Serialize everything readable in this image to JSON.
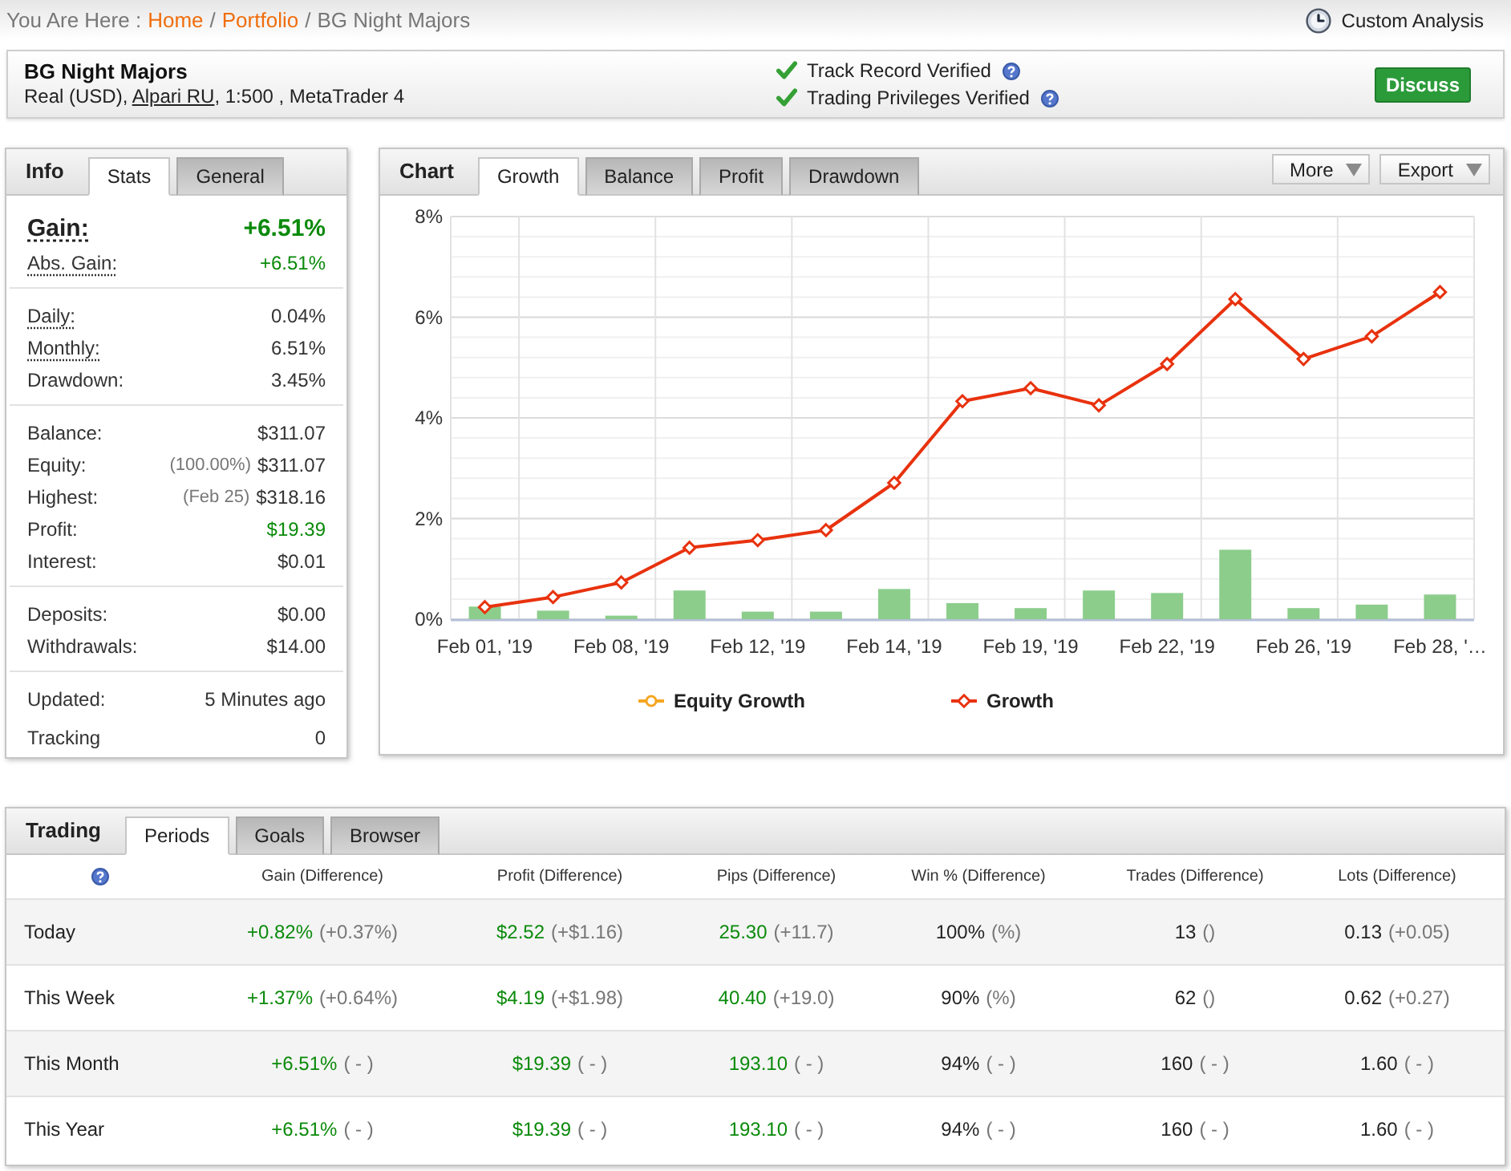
{
  "breadcrumb": [
    {
      "kind": "label",
      "text": "You Are Here :"
    },
    {
      "kind": "link",
      "text": "Home"
    },
    {
      "kind": "separator",
      "text": "/"
    },
    {
      "kind": "link",
      "text": "Portfolio"
    },
    {
      "kind": "separator",
      "text": "/"
    },
    {
      "kind": "current",
      "text": "BG Night Majors"
    }
  ],
  "custom_analysis": {
    "label": "Custom Analysis"
  },
  "account": {
    "name": "BG Night Majors",
    "details": [
      {
        "kind": "text",
        "text": "Real (USD), "
      },
      {
        "kind": "link",
        "text": "Alpari RU"
      },
      {
        "kind": "text",
        "text": ", 1:500 , MetaTrader 4"
      }
    ],
    "verifications": [
      {
        "label": "Track Record Verified",
        "verified": true
      },
      {
        "label": "Trading Privileges Verified",
        "verified": true
      }
    ],
    "button": "Discuss"
  },
  "info_panel": {
    "title": "Info",
    "tabs": [
      {
        "label": "Stats",
        "selected": true
      },
      {
        "label": "General",
        "selected": false
      }
    ],
    "groups": [
      {
        "rows": [
          {
            "kind": "headline",
            "label": "Gain:",
            "value": "+6.51%",
            "underlined": true,
            "highlighted": true
          },
          {
            "kind": "stat",
            "label": "Abs. Gain:",
            "value": "+6.51%",
            "underlined": true,
            "highlighted": true
          }
        ]
      },
      {
        "rows": [
          {
            "kind": "stat",
            "label": "Daily:",
            "value": "0.04%",
            "underlined": true,
            "highlighted": false
          },
          {
            "kind": "stat",
            "label": "Monthly:",
            "value": "6.51%",
            "underlined": true,
            "highlighted": false
          },
          {
            "kind": "stat",
            "label": "Drawdown:",
            "value": "3.45%",
            "underlined": false,
            "highlighted": false
          }
        ]
      },
      {
        "rows": [
          {
            "kind": "stat",
            "label": "Balance:",
            "value": "$311.07",
            "underlined": false,
            "highlighted": false
          },
          {
            "kind": "stat",
            "label": "Equity:",
            "note": "(100.00%)",
            "value": "$311.07",
            "underlined": false,
            "highlighted": false
          },
          {
            "kind": "stat",
            "label": "Highest:",
            "note": "(Feb 25)",
            "value": "$318.16",
            "underlined": false,
            "highlighted": false
          },
          {
            "kind": "stat",
            "label": "Profit:",
            "value": "$19.39",
            "underlined": false,
            "highlighted": true
          },
          {
            "kind": "stat",
            "label": "Interest:",
            "value": "$0.01",
            "underlined": false,
            "highlighted": false
          }
        ]
      },
      {
        "rows": [
          {
            "kind": "stat",
            "label": "Deposits:",
            "value": "$0.00",
            "underlined": false,
            "highlighted": false
          },
          {
            "kind": "stat",
            "label": "Withdrawals:",
            "value": "$14.00",
            "underlined": false,
            "highlighted": false
          }
        ]
      },
      {
        "rows": [
          {
            "kind": "stat",
            "label": "Updated:",
            "value": "5 Minutes ago",
            "underlined": false,
            "highlighted": false
          },
          {
            "kind": "stat",
            "label": "Tracking",
            "value": "0",
            "underlined": false,
            "highlighted": false
          }
        ]
      }
    ]
  },
  "chart_panel": {
    "title": "Chart",
    "tabs": [
      {
        "label": "Growth",
        "selected": true
      },
      {
        "label": "Balance",
        "selected": false
      },
      {
        "label": "Profit",
        "selected": false
      },
      {
        "label": "Drawdown",
        "selected": false
      }
    ],
    "menus": [
      {
        "label": "More"
      },
      {
        "label": "Export"
      }
    ],
    "chart_data": {
      "type": "line",
      "grid": true,
      "categories": [
        "Feb 01, '19",
        null,
        "Feb 08, '19",
        null,
        "Feb 12, '19",
        null,
        "Feb 14, '19",
        null,
        "Feb 19, '19",
        null,
        "Feb 22, '19",
        null,
        "Feb 26, '19",
        null,
        "Feb 28, '…"
      ],
      "ylim": [
        0,
        8
      ],
      "yticks": [
        {
          "value": 0,
          "label": "0%"
        },
        {
          "value": 2,
          "label": "2%"
        },
        {
          "value": 4,
          "label": "4%"
        },
        {
          "value": 6,
          "label": "6%"
        },
        {
          "value": 8,
          "label": "8%"
        }
      ],
      "series": [
        {
          "name": "Equity Growth",
          "color": "#f5a623",
          "type": "line",
          "marker": "circle",
          "values": [
            null,
            null,
            null,
            null,
            null,
            null,
            null,
            null,
            null,
            null,
            null,
            null,
            null,
            null,
            null
          ]
        },
        {
          "name": "Growth",
          "color": "#e8320e",
          "type": "line",
          "marker": "diamond",
          "values": [
            0.24,
            0.44,
            0.73,
            1.42,
            1.57,
            1.77,
            2.71,
            4.33,
            4.59,
            4.25,
            5.07,
            6.36,
            5.17,
            5.62,
            6.5
          ]
        },
        {
          "color": "#8ccd8c",
          "type": "bar",
          "values": [
            0.25,
            0.17,
            0.07,
            0.57,
            0.15,
            0.15,
            0.6,
            0.32,
            0.22,
            0.57,
            0.52,
            1.38,
            0.22,
            0.29,
            0.49
          ]
        }
      ]
    }
  },
  "trading_panel": {
    "title": "Trading",
    "tabs": [
      {
        "label": "Periods",
        "selected": true
      },
      {
        "label": "Goals",
        "selected": false
      },
      {
        "label": "Browser",
        "selected": false
      }
    ],
    "table": {
      "columns": [
        {
          "kind": "help"
        },
        {
          "kind": "label",
          "label": "Gain (Difference)",
          "highlighted": true
        },
        {
          "kind": "label",
          "label": "Profit (Difference)",
          "highlighted": true
        },
        {
          "kind": "label",
          "label": "Pips (Difference)",
          "highlighted": true
        },
        {
          "kind": "label",
          "label": "Win % (Difference)",
          "highlighted": false
        },
        {
          "kind": "label",
          "label": "Trades (Difference)",
          "highlighted": false
        },
        {
          "kind": "label",
          "label": "Lots (Difference)",
          "highlighted": false
        }
      ],
      "rows": [
        {
          "cells": [
            {
              "kind": "label",
              "value": "Today"
            },
            {
              "kind": "value",
              "value": "+0.82%",
              "difference": "(+0.37%)"
            },
            {
              "kind": "value",
              "value": "$2.52",
              "difference": "(+$1.16)"
            },
            {
              "kind": "value",
              "value": "25.30",
              "difference": "(+11.7)"
            },
            {
              "kind": "value",
              "value": "100%",
              "difference": "(%)"
            },
            {
              "kind": "value",
              "value": "13",
              "difference": "()"
            },
            {
              "kind": "value",
              "value": "0.13",
              "difference": "(+0.05)"
            }
          ]
        },
        {
          "cells": [
            {
              "kind": "label",
              "value": "This Week"
            },
            {
              "kind": "value",
              "value": "+1.37%",
              "difference": "(+0.64%)"
            },
            {
              "kind": "value",
              "value": "$4.19",
              "difference": "(+$1.98)"
            },
            {
              "kind": "value",
              "value": "40.40",
              "difference": "(+19.0)"
            },
            {
              "kind": "value",
              "value": "90%",
              "difference": "(%)"
            },
            {
              "kind": "value",
              "value": "62",
              "difference": "()"
            },
            {
              "kind": "value",
              "value": "0.62",
              "difference": "(+0.27)"
            }
          ]
        },
        {
          "cells": [
            {
              "kind": "label",
              "value": "This Month"
            },
            {
              "kind": "value",
              "value": "+6.51%",
              "difference": "( - )"
            },
            {
              "kind": "value",
              "value": "$19.39",
              "difference": "( - )"
            },
            {
              "kind": "value",
              "value": "193.10",
              "difference": "( - )"
            },
            {
              "kind": "value",
              "value": "94%",
              "difference": "( - )"
            },
            {
              "kind": "value",
              "value": "160",
              "difference": "( - )"
            },
            {
              "kind": "value",
              "value": "1.60",
              "difference": "( - )"
            }
          ]
        },
        {
          "cells": [
            {
              "kind": "label",
              "value": "This Year"
            },
            {
              "kind": "value",
              "value": "+6.51%",
              "difference": "( - )"
            },
            {
              "kind": "value",
              "value": "$19.39",
              "difference": "( - )"
            },
            {
              "kind": "value",
              "value": "193.10",
              "difference": "( - )"
            },
            {
              "kind": "value",
              "value": "94%",
              "difference": "( - )"
            },
            {
              "kind": "value",
              "value": "160",
              "difference": "( - )"
            },
            {
              "kind": "value",
              "value": "1.60",
              "difference": "( - )"
            }
          ]
        }
      ]
    }
  }
}
